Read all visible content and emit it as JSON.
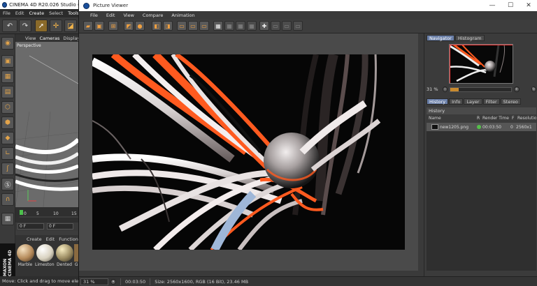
{
  "c4d": {
    "title": "CINEMA 4D R20.026 Studio (RC - R",
    "menu": [
      "File",
      "Edit",
      "Create",
      "Select",
      "Tools"
    ],
    "view_tabs": [
      "View",
      "Cameras",
      "Display"
    ],
    "viewport_label": "Perspective",
    "timeline_ticks": [
      "0",
      "5",
      "10",
      "15"
    ],
    "frame_field": "0 F",
    "frame_field2": "0 F",
    "material_menu": [
      "Create",
      "Edit",
      "Function"
    ],
    "materials": [
      {
        "name": "Marble",
        "color": "#b58a5a"
      },
      {
        "name": "Limestone",
        "color": "#d9d2c0"
      },
      {
        "name": "Dented",
        "color": "#9a8a60"
      },
      {
        "name": "Gl",
        "color": "#8a6a40"
      }
    ],
    "brand_vertical": "MAXON CINEMA 4D",
    "status": "Move: Click and drag to move elem"
  },
  "viewer": {
    "title": "Picture Viewer",
    "window_controls": {
      "minimize": "—",
      "maximize": "☐",
      "close": "✕"
    },
    "menu": [
      "File",
      "Edit",
      "View",
      "Compare",
      "Animation"
    ],
    "panel_tabs_top": [
      "Navigator",
      "Histogram"
    ],
    "zoom_value": "31 %",
    "zoom_fraction": 0.14,
    "panel_tabs_bottom": [
      "History",
      "Info",
      "Layer",
      "Filter",
      "Stereo"
    ],
    "history_title": "History",
    "history_columns": [
      "Name",
      "R",
      "Render Time",
      "F",
      "Resolutio"
    ],
    "history_rows": [
      {
        "name": "new1205.png",
        "render_time": "00:03:50",
        "frame": "0",
        "resolution": "2560x1"
      }
    ],
    "status": {
      "zoom": "31 %",
      "time": "00:03:50",
      "info": "Size: 2560x1600, RGB (16 Bit), 23.46 MB"
    }
  },
  "colors": {
    "accent_orange": "#ff5a1f",
    "ui_dark": "#3c3c3c",
    "active_tab": "#6a7fa8"
  }
}
